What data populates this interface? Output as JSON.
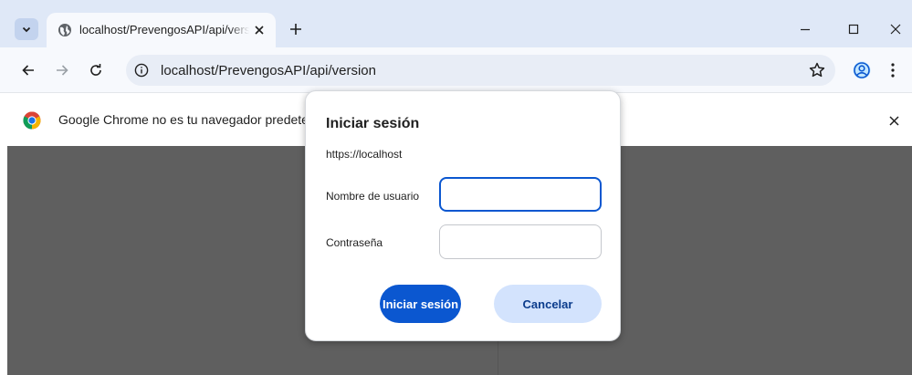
{
  "tab": {
    "title": "localhost/PrevengosAPI/api/version",
    "favicon": "globe-icon"
  },
  "toolbar": {
    "url": "localhost/PrevengosAPI/api/version"
  },
  "infobar": {
    "message": "Google Chrome no es tu navegador predeterminado"
  },
  "dialog": {
    "title": "Iniciar sesión",
    "origin": "https://localhost",
    "username_label": "Nombre de usuario",
    "username_value": "",
    "password_label": "Contraseña",
    "password_value": "",
    "signin_label": "Iniciar sesión",
    "cancel_label": "Cancelar"
  },
  "colors": {
    "tabstrip": "#dfe8f7",
    "primary_button": "#0b57d0",
    "secondary_button": "#d3e3fd",
    "page_background": "#5f5f5f"
  }
}
